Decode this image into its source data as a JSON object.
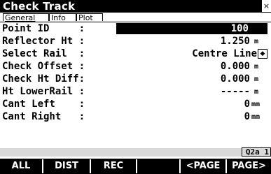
{
  "window": {
    "title": "Check Track",
    "close_glyph": "×"
  },
  "tabs": [
    {
      "label": "General"
    },
    {
      "label": "Info"
    },
    {
      "label": "Plot"
    }
  ],
  "fields": {
    "point_id": {
      "label": "Point ID     :",
      "value": "100"
    },
    "reflector_ht": {
      "label": "Reflector Ht :",
      "value": "1.250",
      "unit": "m"
    },
    "select_rail": {
      "label": "Select Rail  :",
      "value": "Centre Line"
    },
    "check_offset": {
      "label": "Check Offset :",
      "value": "0.000",
      "unit": "m"
    },
    "check_ht_diff": {
      "label": "Check Ht Diff:",
      "value": "0.000",
      "unit": "m"
    },
    "ht_lowerrail": {
      "label": "Ht LowerRail :",
      "value": "-----",
      "unit": "m"
    },
    "cant_left": {
      "label": "Cant Left    :",
      "value": "0",
      "unit": "mm"
    },
    "cant_right": {
      "label": "Cant Right   :",
      "value": "0",
      "unit": "mm"
    }
  },
  "status": {
    "indicator": "Q2a 1"
  },
  "function_keys": [
    {
      "label": "ALL"
    },
    {
      "label": "DIST"
    },
    {
      "label": "REC"
    },
    {
      "label": ""
    },
    {
      "label": "<PAGE"
    },
    {
      "label": "PAGE>"
    }
  ],
  "icons": {
    "rail_toggle": "updown-arrow-icon"
  }
}
